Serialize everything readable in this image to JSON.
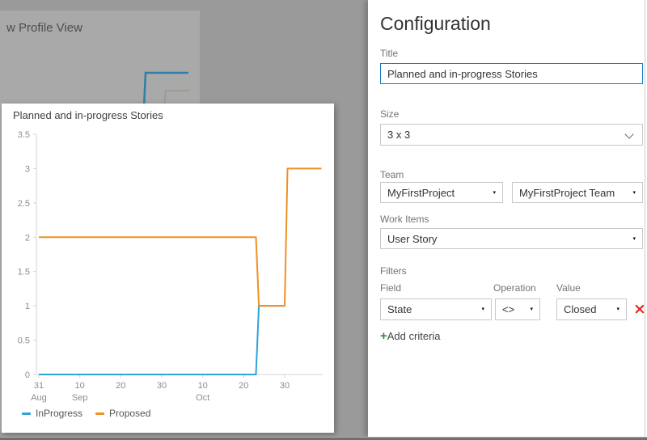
{
  "overlay": {
    "background_widget": {
      "visible_title": "w Profile View"
    }
  },
  "preview_card": {
    "title": "Planned and in-progress Stories"
  },
  "chart_data": {
    "type": "line",
    "title": "Planned and in-progress Stories",
    "x_axis": {
      "unit": "days since Aug 31",
      "max_day": 69,
      "ticks": [
        {
          "day": 0,
          "label": "31",
          "month": "Aug"
        },
        {
          "day": 10,
          "label": "10",
          "month": "Sep"
        },
        {
          "day": 20,
          "label": "20",
          "month": ""
        },
        {
          "day": 30,
          "label": "30",
          "month": ""
        },
        {
          "day": 40,
          "label": "10",
          "month": "Oct"
        },
        {
          "day": 50,
          "label": "20",
          "month": ""
        },
        {
          "day": 60,
          "label": "30",
          "month": ""
        }
      ]
    },
    "y_axis": {
      "min": 0,
      "max": 3.5,
      "step": 0.5
    },
    "series": [
      {
        "name": "InProgress",
        "color": "#2ea3d9",
        "points": [
          [
            0,
            0
          ],
          [
            53,
            0
          ],
          [
            53.7,
            1
          ],
          [
            60,
            1
          ]
        ]
      },
      {
        "name": "Proposed",
        "color": "#ef9123",
        "points": [
          [
            0,
            2
          ],
          [
            53,
            2
          ],
          [
            53.7,
            1
          ],
          [
            60,
            1
          ],
          [
            60.7,
            3
          ],
          [
            69,
            3
          ]
        ]
      }
    ],
    "legend_position": "bottom-left",
    "grid": false
  },
  "config_panel": {
    "heading": "Configuration",
    "title_field": {
      "label": "Title",
      "value": "Planned and in-progress Stories"
    },
    "size_field": {
      "label": "Size",
      "value": "3 x 3"
    },
    "team_field": {
      "label": "Team",
      "project": "MyFirstProject",
      "team": "MyFirstProject Team"
    },
    "work_items_field": {
      "label": "Work Items",
      "value": "User Story"
    },
    "filters": {
      "section_label": "Filters",
      "field_column_label": "Field",
      "operation_column_label": "Operation",
      "value_column_label": "Value",
      "rows": [
        {
          "field": "State",
          "operation": "<>",
          "value": "Closed"
        }
      ],
      "remove_glyph": "×",
      "add_glyph": "+",
      "add_label": "Add criteria"
    },
    "icons": {
      "dropdown_arrow": "▾"
    },
    "colors": {
      "focus_border": "#1b7dc0",
      "remove_red": "#dd2c1a",
      "add_green": "#2f8f2f",
      "series_blue": "#2ea3d9",
      "series_orange": "#ef9123"
    }
  }
}
